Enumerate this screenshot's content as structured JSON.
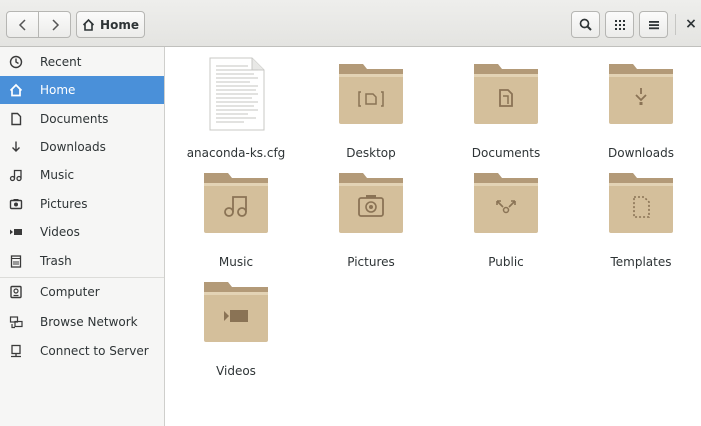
{
  "header": {
    "back_icon": "chevron-left-icon",
    "forward_icon": "chevron-right-icon",
    "path_label": "Home",
    "search_icon": "search-icon",
    "view_icon": "grid-view-icon",
    "menu_icon": "hamburger-menu-icon",
    "close_label": "×"
  },
  "sidebar": {
    "items": [
      {
        "label": "Recent",
        "icon": "clock-icon"
      },
      {
        "label": "Home",
        "icon": "home-icon",
        "selected": true
      },
      {
        "label": "Documents",
        "icon": "document-icon"
      },
      {
        "label": "Downloads",
        "icon": "download-icon"
      },
      {
        "label": "Music",
        "icon": "music-icon"
      },
      {
        "label": "Pictures",
        "icon": "camera-icon"
      },
      {
        "label": "Videos",
        "icon": "video-icon"
      },
      {
        "label": "Trash",
        "icon": "trash-icon"
      },
      {
        "label": "Computer",
        "icon": "drive-icon"
      },
      {
        "label": "Browse Network",
        "icon": "network-icon"
      },
      {
        "label": "Connect to Server",
        "icon": "server-icon"
      }
    ]
  },
  "files": [
    {
      "name": "anaconda-ks.cfg",
      "type": "text-file"
    },
    {
      "name": "Desktop",
      "type": "folder"
    },
    {
      "name": "Documents",
      "type": "folder"
    },
    {
      "name": "Downloads",
      "type": "folder"
    },
    {
      "name": "Music",
      "type": "folder"
    },
    {
      "name": "Pictures",
      "type": "folder"
    },
    {
      "name": "Public",
      "type": "folder"
    },
    {
      "name": "Templates",
      "type": "folder"
    },
    {
      "name": "Videos",
      "type": "folder"
    }
  ],
  "colors": {
    "selection": "#4a90d9",
    "folder": "#d4bf9b",
    "folder_dark": "#b39a78"
  }
}
